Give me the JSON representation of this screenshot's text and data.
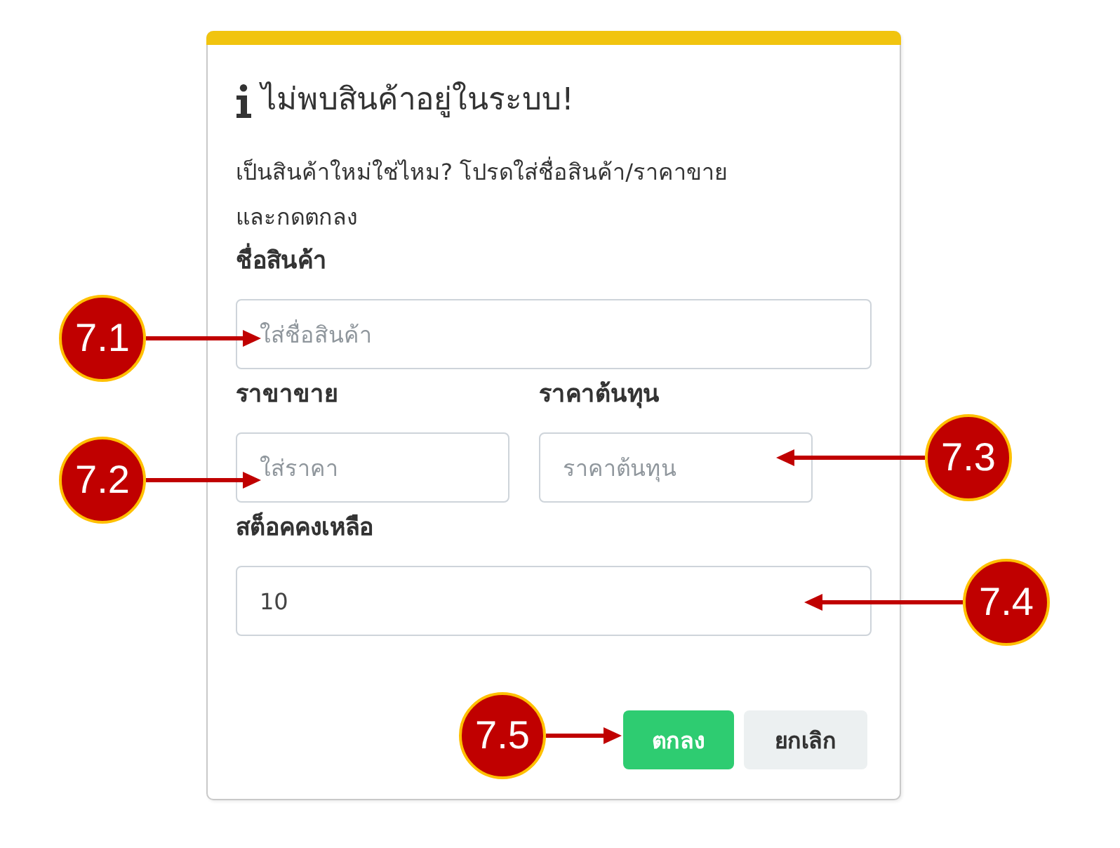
{
  "dialog": {
    "title": "ไม่พบสินค้าอยู่ในระบบ!",
    "message": "เป็นสินค้าใหม่ใช่ไหม? โปรดใส่ชื่อสินค้า/ราคาขาย และกดตกลง",
    "form_rows": [
      {
        "fields": [
          {
            "label": "ชื่อสินค้า",
            "placeholder": "ใส่ชื่อสินค้า"
          }
        ]
      },
      {
        "fields": [
          {
            "label": "ราขาขาย",
            "placeholder": "ใส่ราคา"
          },
          {
            "label": "ราคาต้นทุน",
            "placeholder": "ราคาต้นทุน"
          }
        ]
      },
      {
        "fields": [
          {
            "label": "สต็อคคงเหลือ",
            "value": "10"
          }
        ]
      }
    ],
    "buttons": [
      {
        "label": "ตกลง",
        "kind": "primary"
      },
      {
        "label": "ยกเลิก",
        "kind": "secondary"
      }
    ]
  },
  "callouts": [
    "7.1",
    "7.2",
    "7.3",
    "7.4",
    "7.5"
  ]
}
